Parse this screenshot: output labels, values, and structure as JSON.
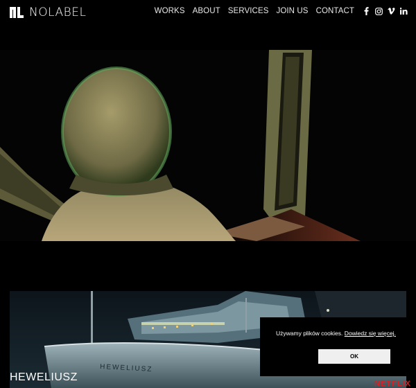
{
  "header": {
    "logo_text": "NOLABEL",
    "nav": [
      "WORKS",
      "ABOUT",
      "SERVICES",
      "JOIN US",
      "CONTACT"
    ],
    "social": [
      {
        "icon": "facebook-icon",
        "glyph": "f"
      },
      {
        "icon": "instagram-icon",
        "glyph": "◎"
      },
      {
        "icon": "vimeo-icon",
        "glyph": "v"
      },
      {
        "icon": "linkedin-icon",
        "glyph": "in"
      }
    ]
  },
  "project": {
    "title": "HEWELIUSZ",
    "ship_name": "HEWELIUSZ",
    "brand": "NETFLIX"
  },
  "cookie": {
    "text": "Używamy plików cookies.",
    "link": "Dowiedz się więcej.",
    "button": "OK"
  },
  "colors": {
    "background": "#000000",
    "brand_red": "#d71f26",
    "button_bg": "#efefef"
  }
}
